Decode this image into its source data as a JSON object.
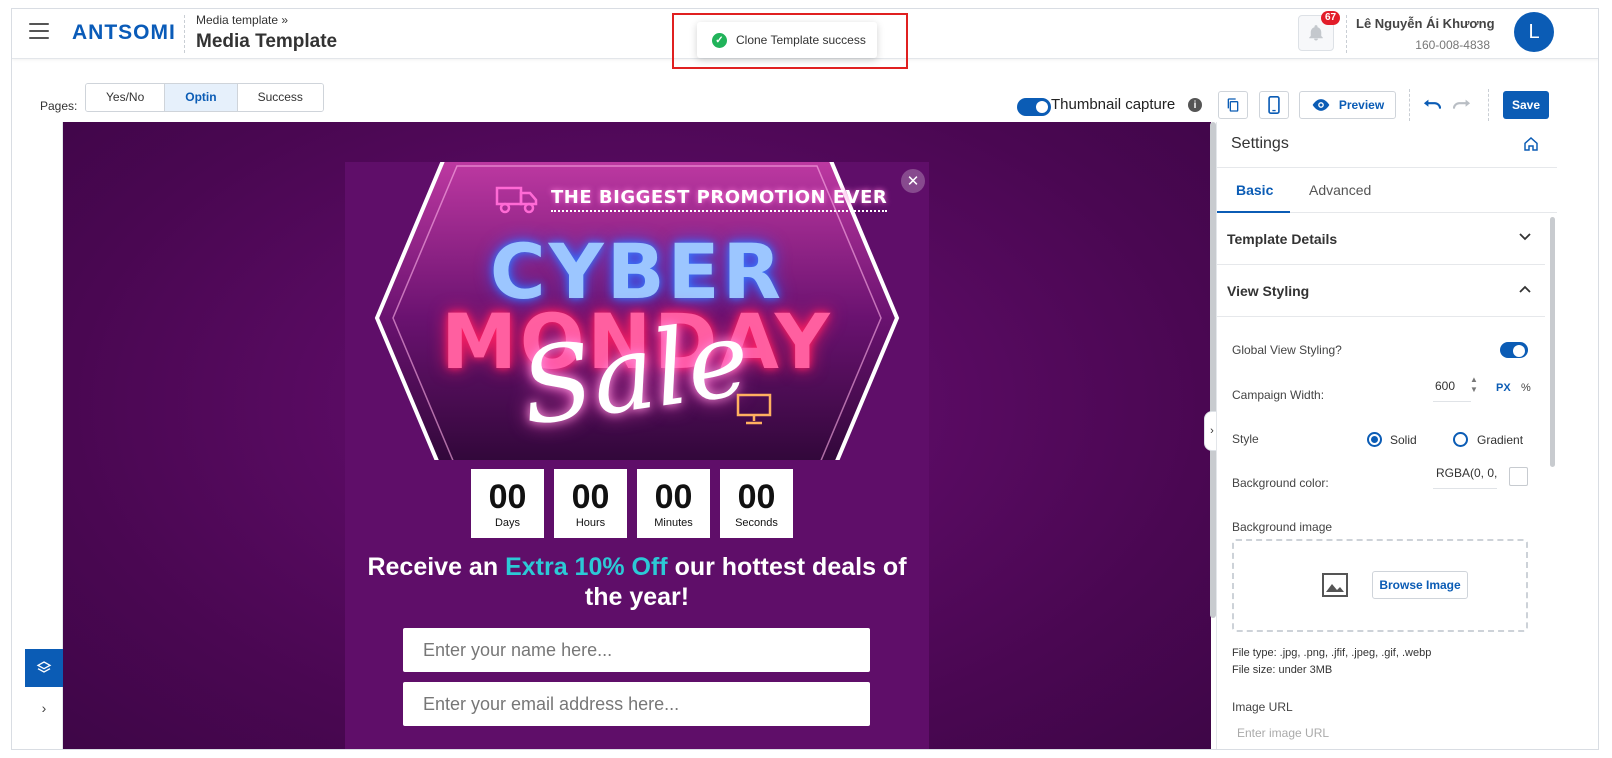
{
  "header": {
    "logo": "ANTSOMI",
    "breadcrumb": "Media template »",
    "title": "Media Template",
    "notification_count": "67",
    "user_name": "Lê Nguyễn Ái Khương",
    "user_phone": "160-008-4838",
    "avatar_letter": "L"
  },
  "toast": {
    "message": "Clone Template success",
    "status_color": "#21b35a"
  },
  "toolbar": {
    "pages_label": "Pages:",
    "page_tabs": [
      {
        "label": "Yes/No",
        "active": false
      },
      {
        "label": "Optin",
        "active": true
      },
      {
        "label": "Success",
        "active": false
      }
    ],
    "thumbnail_label": "Thumbnail capture",
    "thumbnail_enabled": true,
    "preview_label": "Preview",
    "save_label": "Save"
  },
  "canvas": {
    "banner": {
      "tagline": "THE BIGGEST PROMOTION EVER",
      "line1": "CYBER",
      "line2": "MONDAY",
      "script": "Sale"
    },
    "countdown": [
      {
        "value": "00",
        "label": "Days"
      },
      {
        "value": "00",
        "label": "Hours"
      },
      {
        "value": "00",
        "label": "Minutes"
      },
      {
        "value": "00",
        "label": "Seconds"
      }
    ],
    "headline_pre": "Receive an ",
    "headline_accent": "Extra 10% Off",
    "headline_post": " our hottest deals of the year!",
    "name_placeholder": "Enter your name here...",
    "email_placeholder": "Enter your email address here..."
  },
  "settings": {
    "title": "Settings",
    "tabs": [
      {
        "label": "Basic",
        "active": true
      },
      {
        "label": "Advanced",
        "active": false
      }
    ],
    "sections": {
      "template_details": "Template Details",
      "view_styling": "View Styling"
    },
    "global_view_label": "Global View Styling?",
    "global_view_enabled": true,
    "campaign_width_label": "Campaign Width:",
    "campaign_width_value": "600",
    "unit_px": "PX",
    "unit_percent": "%",
    "unit_selected": "PX",
    "style_label": "Style",
    "style_options": [
      {
        "label": "Solid",
        "checked": true
      },
      {
        "label": "Gradient",
        "checked": false
      }
    ],
    "bg_color_label": "Background color:",
    "bg_color_value": "RGBA(0, 0, 0",
    "bg_image_label": "Background image",
    "browse_label": "Browse Image",
    "file_type": "File type: .jpg, .png, .jfif, .jpeg, .gif, .webp",
    "file_size": "File size: under 3MB",
    "image_url_label": "Image URL",
    "image_url_placeholder": "Enter image URL"
  },
  "colors": {
    "brand": "#0b5cb5",
    "accent": "#2cc9d6",
    "popup_bg": "#5f0e69",
    "badge": "#e21d2a"
  }
}
